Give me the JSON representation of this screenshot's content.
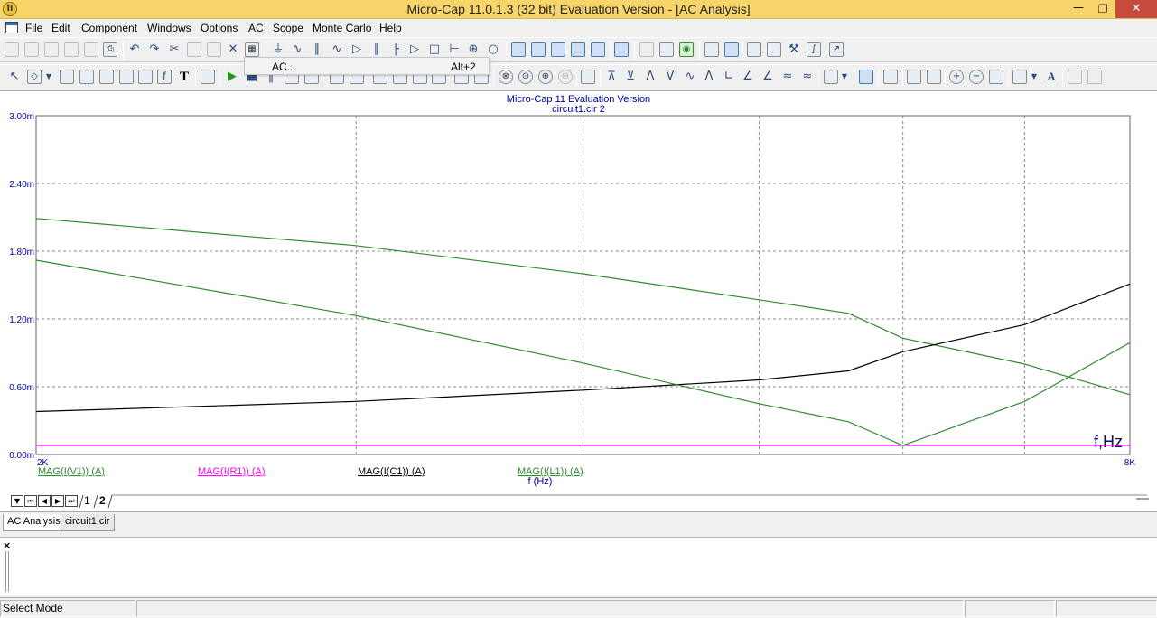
{
  "window": {
    "title": "Micro-Cap 11.0.1.3 (32 bit) Evaluation Version - [AC Analysis]",
    "app_icon": "II"
  },
  "menu": [
    "File",
    "Edit",
    "Component",
    "Windows",
    "Options",
    "AC",
    "Scope",
    "Monte Carlo",
    "Help"
  ],
  "dropdown": {
    "label": "AC...",
    "shortcut": "Alt+2"
  },
  "plot": {
    "title": "Micro-Cap 11 Evaluation Version",
    "subtitle": "circuit1.cir 2",
    "x_unit_label": "f,Hz",
    "x_axis_label": "f (Hz)"
  },
  "chart_data": {
    "type": "line",
    "title": "Micro-Cap 11 Evaluation Version",
    "subtitle": "circuit1.cir 2",
    "xlabel": "f (Hz)",
    "xlim": [
      2000,
      8000
    ],
    "x_tick_labels": [
      "2K",
      "8K"
    ],
    "ylim": [
      0,
      0.003
    ],
    "y_tick_labels": [
      "3.00m",
      "2.40m",
      "1.80m",
      "1.20m",
      "0.60m",
      "0.00m"
    ],
    "grid": true,
    "x": [
      2000,
      3000,
      4000,
      5000,
      5600,
      6000,
      7000,
      8000
    ],
    "series": [
      {
        "name": "MAG(I(V1)) (A)",
        "color": "#2e8b2e",
        "values": [
          0.00209,
          0.00185,
          0.0016,
          0.00137,
          0.00125,
          0.00103,
          0.0008,
          0.00053
        ]
      },
      {
        "name": "MAG(I(R1)) (A)",
        "color": "#ff00ff",
        "values": [
          8e-05,
          8e-05,
          8e-05,
          8e-05,
          8e-05,
          8e-05,
          8e-05,
          8e-05
        ]
      },
      {
        "name": "MAG(I(C1)) (A)",
        "color": "#000000",
        "values": [
          0.00038,
          0.00047,
          0.00057,
          0.00066,
          0.00074,
          0.00091,
          0.00115,
          0.00151
        ]
      },
      {
        "name": "MAG(I(L1)) (A)",
        "color": "#2e8b2e",
        "values": [
          0.00172,
          0.00123,
          0.00081,
          0.00045,
          0.00029,
          8e-05,
          0.00047,
          0.00099
        ]
      }
    ]
  },
  "page_tabs": [
    "1",
    "2"
  ],
  "doc_tabs": [
    "AC Analysis",
    "circuit1.cir"
  ],
  "status": {
    "mode": "Select Mode"
  }
}
